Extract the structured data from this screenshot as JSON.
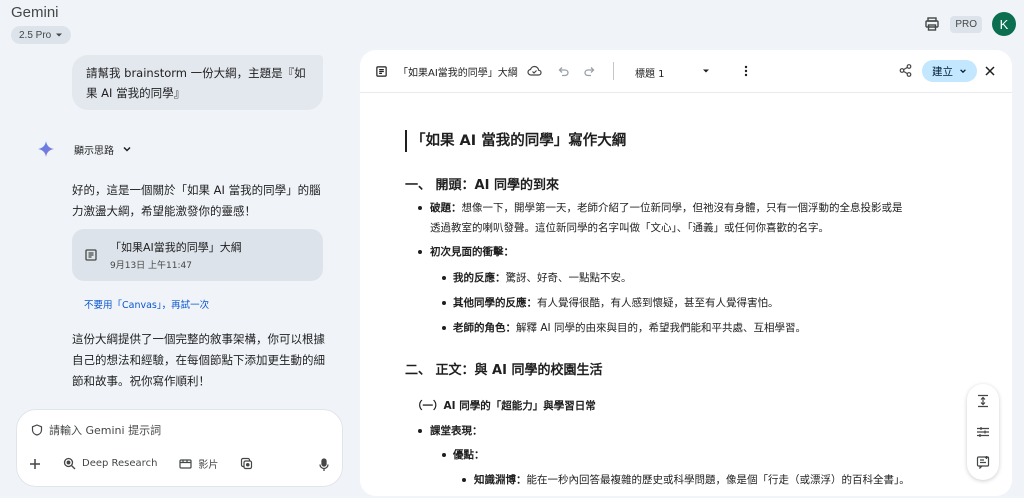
{
  "app": {
    "title": "Gemini",
    "model": "2.5 Pro",
    "pro_badge": "PRO",
    "avatar_letter": "K"
  },
  "chat": {
    "user_message": "請幫我 brainstorm 一份大綱，主題是『如果 AI 當我的同學』",
    "thinking_label": "顯示思路",
    "reply_intro": "好的，這是一個關於「如果 AI 當我的同學」的腦力激盪大綱，希望能激發你的靈感！",
    "doc_card": {
      "title": "「如果AI當我的同學」大綱",
      "date": "9月13日 上午11:47"
    },
    "retry_link": "不要用「Canvas」，再試一次",
    "reply_outro": "這份大綱提供了一個完整的敘事架構，你可以根據自己的想法和經驗，在每個節點下添加更生動的細節和故事。祝你寫作順利！"
  },
  "input": {
    "placeholder": "請輸入 Gemini 提示詞",
    "tools": [
      {
        "icon": "deep-research-icon",
        "label": "Deep Research"
      },
      {
        "icon": "video-icon",
        "label": "影片"
      }
    ]
  },
  "panel": {
    "doc_title": "「如果AI當我的同學」大綱",
    "text_style": "標題 1",
    "create_label": "建立"
  },
  "doc": {
    "title": "「如果 AI 當我的同學」寫作大綱",
    "section1": {
      "heading": "一、 開頭：AI 同學的到來",
      "items": [
        {
          "label": "破題：",
          "text": "想像一下，開學第一天，老師介紹了一位新同學，但祂沒有身體，只有一個浮動的全息投影或是",
          "cont": "透過教室的喇叭發聲。這位新同學的名字叫做「文心」、「通義」或任何你喜歡的名字。"
        },
        {
          "label": "初次見面的衝擊：",
          "text": ""
        }
      ],
      "sub_items": [
        {
          "label": "我的反應：",
          "text": "驚訝、好奇、一點點不安。"
        },
        {
          "label": "其他同學的反應：",
          "text": "有人覺得很酷，有人感到懷疑，甚至有人覺得害怕。"
        },
        {
          "label": "老師的角色：",
          "text": "解釋 AI 同學的由來與目的，希望我們能和平共處、互相學習。"
        }
      ]
    },
    "section2": {
      "heading": "二、 正文：與 AI 同學的校園生活",
      "sub_heading": "（一）AI 同學的「超能力」與學習日常",
      "classroom": "課堂表現：",
      "advantages": "優點：",
      "knowledge": {
        "label": "知識淵博：",
        "text": "能在一秒內回答最複雜的歷史或科學問題，像是個「行走（或漂浮）的百科全書」。"
      }
    }
  },
  "colors": {
    "background": "#f0f4f9",
    "accent": "#0b57d0",
    "create_button": "#c2e7ff",
    "avatar": "#0b6e4f"
  }
}
